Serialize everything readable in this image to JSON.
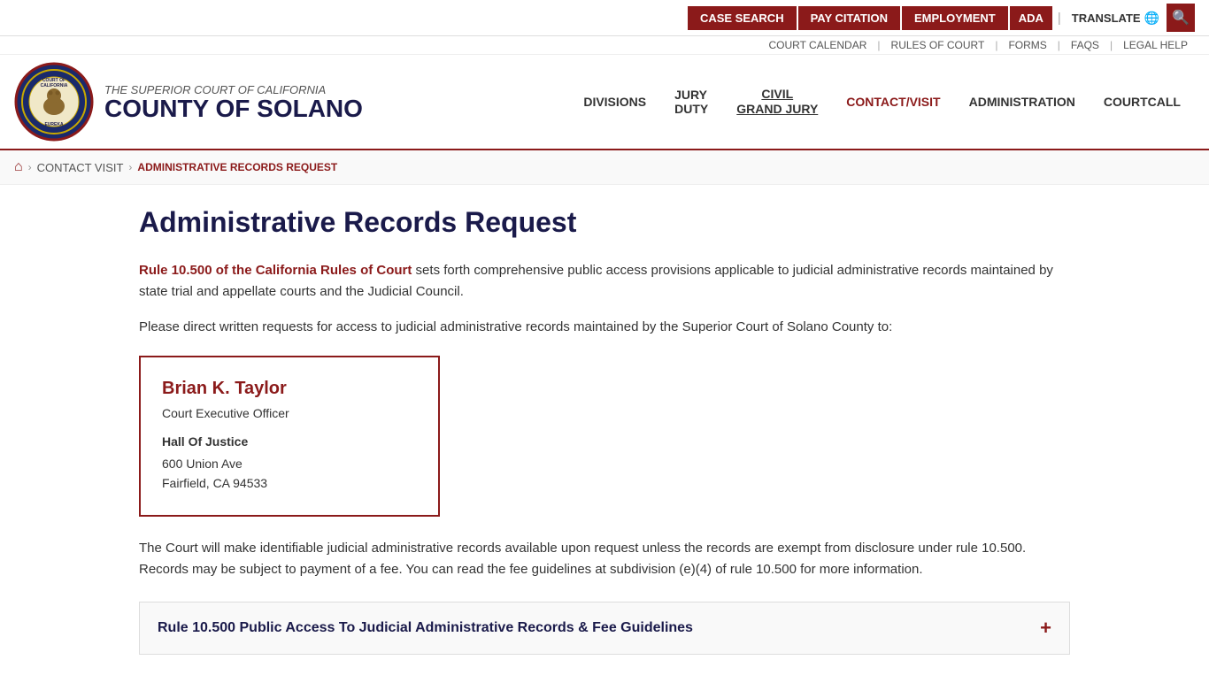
{
  "topbar": {
    "case_search": "CASE SEARCH",
    "pay_citation": "PAY CITATION",
    "employment": "EMPLOYMENT",
    "ada": "ADA",
    "translate": "TRANSLATE",
    "search_icon": "🔍"
  },
  "secondary_links": {
    "court_calendar": "COURT CALENDAR",
    "rules_of_court": "RULES OF COURT",
    "forms": "FORMS",
    "faqs": "FAQS",
    "legal_help": "LEGAL HELP"
  },
  "logo": {
    "court_name": "THE SUPERIOR COURT OF CALIFORNIA",
    "county_name": "COUNTY OF SOLANO"
  },
  "nav": {
    "divisions": "DIVISIONS",
    "jury_duty": "JURY DUTY",
    "civil": "CIVIL",
    "grand_jury": "GRAND JURY",
    "contact_visit": "CONTACT/VISIT",
    "administration": "ADMINISTRATION",
    "courtcall": "COURTCALL"
  },
  "breadcrumb": {
    "home_icon": "⌂",
    "contact_visit": "CONTACT VISIT",
    "current": "ADMINISTRATIVE RECORDS REQUEST"
  },
  "page": {
    "title": "Administrative Records Request",
    "intro_link_text": "Rule 10.500 of the California Rules of Court",
    "intro_rest": " sets forth comprehensive public access provisions applicable to judicial administrative records maintained by state trial and appellate courts and the Judicial Council.",
    "direct_text": "Please direct written requests for access to judicial administrative records maintained by the Superior Court of Solano County to:",
    "contact_name": "Brian K. Taylor",
    "contact_title": "Court Executive Officer",
    "contact_location": "Hall Of Justice",
    "contact_address_1": "600 Union Ave",
    "contact_address_2": "Fairfield, CA 94533",
    "body_text": "The Court will make identifiable judicial administrative records available upon request unless the records are exempt from disclosure under rule 10.500. Records may be subject to payment of a fee. You can read the fee guidelines at subdivision (e)(4) of rule 10.500 for more information.",
    "accordion_title": "Rule 10.500 Public Access To Judicial Administrative Records & Fee Guidelines",
    "accordion_icon": "+"
  }
}
